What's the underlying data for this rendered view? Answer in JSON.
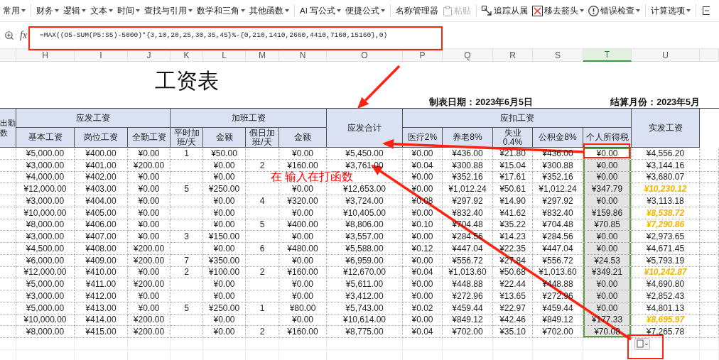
{
  "toolbar": {
    "groups": [
      {
        "items": [
          {
            "label": "常用",
            "kind": "text",
            "dropdown": true,
            "disabled": false
          }
        ]
      },
      {
        "items": [
          {
            "label": "财务",
            "kind": "text",
            "dropdown": true,
            "disabled": false
          },
          {
            "label": "逻辑",
            "kind": "text",
            "dropdown": true,
            "disabled": false
          },
          {
            "label": "文本",
            "kind": "text",
            "dropdown": true,
            "disabled": false
          },
          {
            "label": "时间",
            "kind": "text",
            "dropdown": true,
            "disabled": false
          },
          {
            "label": "查找与引用",
            "kind": "text",
            "dropdown": true,
            "disabled": false
          },
          {
            "label": "数学和三角",
            "kind": "text",
            "dropdown": true,
            "disabled": false
          },
          {
            "label": "其他函数",
            "kind": "text",
            "dropdown": true,
            "disabled": false
          }
        ]
      },
      {
        "items": [
          {
            "label": "AI 写公式",
            "kind": "text",
            "dropdown": true,
            "disabled": false
          },
          {
            "label": "便捷公式",
            "kind": "text",
            "dropdown": true,
            "disabled": false
          }
        ]
      },
      {
        "items": [
          {
            "label": "名称管理器",
            "kind": "text",
            "dropdown": false,
            "disabled": false
          },
          {
            "label": "粘贴",
            "kind": "paste",
            "dropdown": false,
            "disabled": true
          }
        ]
      },
      {
        "items": [
          {
            "label": "追踪从属",
            "kind": "trace",
            "dropdown": false,
            "disabled": false
          },
          {
            "label": "移去箭头",
            "kind": "remove-arrows",
            "dropdown": true,
            "disabled": false
          },
          {
            "label": "错误检查",
            "kind": "error-check",
            "dropdown": true,
            "disabled": false
          }
        ]
      },
      {
        "items": [
          {
            "label": "计算选项",
            "kind": "text",
            "dropdown": true,
            "disabled": false
          }
        ]
      }
    ]
  },
  "formula_bar": {
    "fx_label": "fx",
    "formula": "=MAX((O5-SUM(P5:S5)-5000)*{3,10,20,25,30,35,45}%-{0,210,1410,2660,4410,7160,15160},0)"
  },
  "column_headers": [
    {
      "label": "H",
      "selected": false
    },
    {
      "label": "I",
      "selected": false
    },
    {
      "label": "J",
      "selected": false
    },
    {
      "label": "K",
      "selected": false
    },
    {
      "label": "L",
      "selected": false
    },
    {
      "label": "M",
      "selected": false
    },
    {
      "label": "N",
      "selected": false
    },
    {
      "label": "O",
      "selected": false
    },
    {
      "label": "P",
      "selected": false
    },
    {
      "label": "Q",
      "selected": false
    },
    {
      "label": "R",
      "selected": false
    },
    {
      "label": "S",
      "selected": false
    },
    {
      "label": "T",
      "selected": true
    },
    {
      "label": "U",
      "selected": false
    }
  ],
  "sheet": {
    "title": "工资表",
    "date_label": "制表日期：2023年6月5日",
    "month_label": "结算月份：2023年5月",
    "cut_header": "出勤数",
    "header_groups": [
      {
        "label": "应发工资",
        "columns": [
          "基本工资",
          "岗位工资",
          "全勤工资"
        ]
      },
      {
        "label": "加班工资",
        "columns": [
          "平时加班/天",
          "金额",
          "假日加班/天",
          "金额"
        ]
      },
      {
        "label": "应发合计"
      },
      {
        "label": "应扣工资",
        "columns": [
          "医疗2%",
          "养老8%",
          "失业0.4%",
          "公积金8%",
          "个人所得税"
        ]
      },
      {
        "label": "实发工资"
      }
    ],
    "rows": [
      {
        "active": true,
        "highlighted": false,
        "cells": [
          "¥5,000.00",
          "¥400.00",
          "¥0.00",
          "1",
          "¥50.00",
          "",
          "¥0.00",
          "¥5,450.00",
          "¥0.00",
          "¥436.00",
          "¥21.80",
          "¥436.00",
          "¥0.00",
          "¥4,556.20"
        ]
      },
      {
        "active": false,
        "highlighted": false,
        "cells": [
          "¥3,000.00",
          "¥401.00",
          "¥200.00",
          "",
          "¥0.00",
          "2",
          "¥160.00",
          "¥3,761.00",
          "¥0.04",
          "¥300.88",
          "¥15.04",
          "¥300.88",
          "¥0.00",
          "¥3,144.16"
        ]
      },
      {
        "active": false,
        "highlighted": false,
        "note": "在 输入在打函数",
        "cells": [
          "¥4,000.00",
          "¥402.00",
          "¥0.00",
          "",
          "¥0.00",
          "",
          "",
          "",
          "¥0.00",
          "¥352.16",
          "¥17.61",
          "¥352.16",
          "¥0.00",
          "¥3,680.07"
        ]
      },
      {
        "active": false,
        "highlighted": true,
        "cells": [
          "¥12,000.00",
          "¥403.00",
          "¥0.00",
          "5",
          "¥250.00",
          "",
          "¥0.00",
          "¥12,653.00",
          "¥0.00",
          "¥1,012.24",
          "¥50.61",
          "¥1,012.24",
          "¥347.79",
          "¥10,230.12"
        ]
      },
      {
        "active": false,
        "highlighted": false,
        "cells": [
          "¥3,000.00",
          "¥404.00",
          "¥0.00",
          "",
          "¥0.00",
          "4",
          "¥320.00",
          "¥3,724.00",
          "¥0.08",
          "¥297.92",
          "¥14.90",
          "¥297.92",
          "¥0.00",
          "¥3,113.18"
        ]
      },
      {
        "active": false,
        "highlighted": true,
        "cells": [
          "¥10,000.00",
          "¥405.00",
          "¥0.00",
          "",
          "¥0.00",
          "",
          "¥0.00",
          "¥10,405.00",
          "¥0.00",
          "¥832.40",
          "¥41.62",
          "¥832.40",
          "¥159.86",
          "¥8,538.72"
        ]
      },
      {
        "active": false,
        "highlighted": true,
        "cells": [
          "¥8,000.00",
          "¥406.00",
          "¥0.00",
          "",
          "¥0.00",
          "5",
          "¥400.00",
          "¥8,806.00",
          "¥0.10",
          "¥704.48",
          "¥35.22",
          "¥704.48",
          "¥70.85",
          "¥7,290.86"
        ]
      },
      {
        "active": false,
        "highlighted": false,
        "cells": [
          "¥3,000.00",
          "¥407.00",
          "¥0.00",
          "3",
          "¥150.00",
          "",
          "¥0.00",
          "¥3,557.00",
          "¥0.00",
          "¥284.56",
          "¥14.23",
          "¥284.56",
          "¥0.00",
          "¥2,973.65"
        ]
      },
      {
        "active": false,
        "highlighted": false,
        "cells": [
          "¥4,500.00",
          "¥408.00",
          "¥200.00",
          "",
          "¥0.00",
          "6",
          "¥480.00",
          "¥5,588.00",
          "¥0.12",
          "¥447.04",
          "¥22.35",
          "¥447.04",
          "¥0.00",
          "¥4,671.45"
        ]
      },
      {
        "active": false,
        "highlighted": false,
        "cells": [
          "¥6,000.00",
          "¥409.00",
          "¥200.00",
          "7",
          "¥350.00",
          "",
          "¥0.00",
          "¥6,959.00",
          "¥0.00",
          "¥556.72",
          "¥27.84",
          "¥556.72",
          "¥24.53",
          "¥5,793.19"
        ]
      },
      {
        "active": false,
        "highlighted": true,
        "cells": [
          "¥12,000.00",
          "¥410.00",
          "¥0.00",
          "2",
          "¥100.00",
          "2",
          "¥160.00",
          "¥12,670.00",
          "¥0.04",
          "¥1,013.60",
          "¥50.68",
          "¥1,013.60",
          "¥349.21",
          "¥10,242.87"
        ]
      },
      {
        "active": false,
        "highlighted": false,
        "cells": [
          "¥5,000.00",
          "¥411.00",
          "¥200.00",
          "",
          "¥0.00",
          "",
          "¥0.00",
          "¥5,611.00",
          "¥0.00",
          "¥448.88",
          "¥22.44",
          "¥448.88",
          "¥0.00",
          "¥4,690.80"
        ]
      },
      {
        "active": false,
        "highlighted": false,
        "cells": [
          "¥3,000.00",
          "¥412.00",
          "¥0.00",
          "",
          "¥0.00",
          "",
          "¥0.00",
          "¥3,412.00",
          "¥0.00",
          "¥272.96",
          "¥13.65",
          "¥272.96",
          "¥0.00",
          "¥2,852.43"
        ]
      },
      {
        "active": false,
        "highlighted": false,
        "cells": [
          "¥5,000.00",
          "¥413.00",
          "¥0.00",
          "5",
          "¥250.00",
          "1",
          "¥80.00",
          "¥5,743.00",
          "¥0.02",
          "¥459.44",
          "¥22.97",
          "¥459.44",
          "¥0.00",
          "¥4,801.13"
        ]
      },
      {
        "active": false,
        "highlighted": true,
        "cells": [
          "¥10,000.00",
          "¥414.00",
          "¥200.00",
          "",
          "¥0.00",
          "",
          "¥0.00",
          "¥10,614.00",
          "¥0.00",
          "¥849.12",
          "¥42.46",
          "¥849.12",
          "¥177.33",
          "¥8,695.97"
        ]
      },
      {
        "active": false,
        "highlighted": false,
        "cells": [
          "¥8,000.00",
          "¥415.00",
          "¥200.00",
          "",
          "¥0.00",
          "2",
          "¥160.00",
          "¥8,775.00",
          "¥0.04",
          "¥702.00",
          "¥35.10",
          "¥702.00",
          "¥70.08",
          "¥7,265.78"
        ]
      }
    ]
  }
}
